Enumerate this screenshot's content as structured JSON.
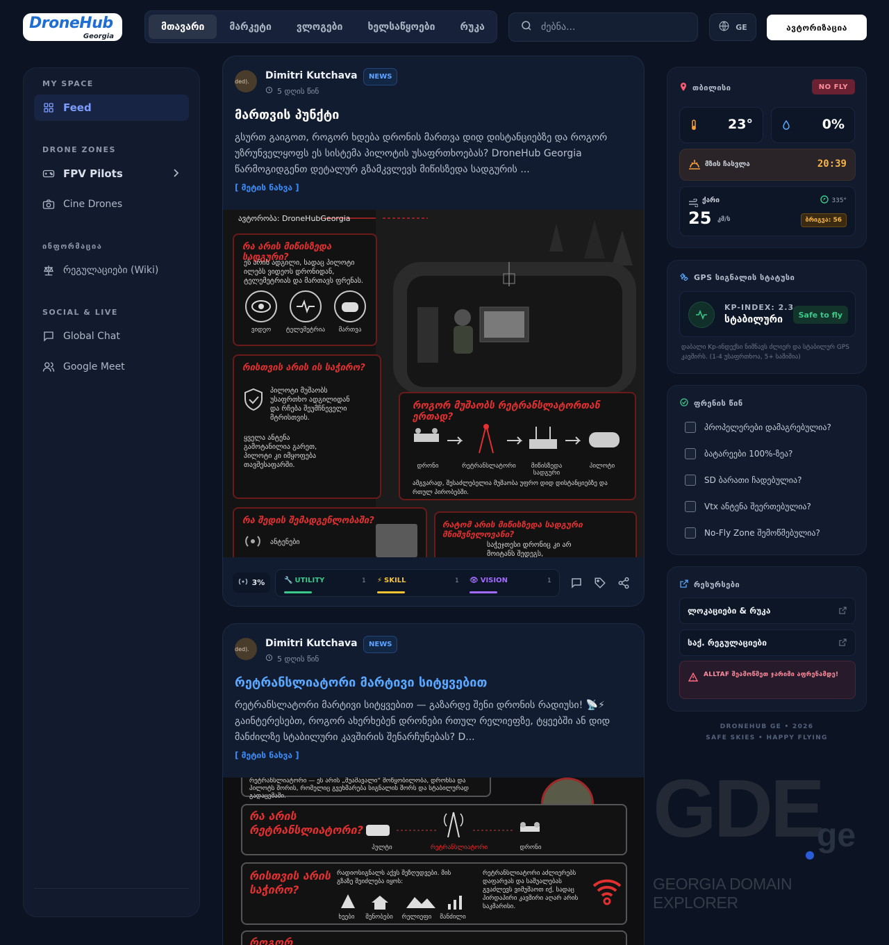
{
  "brand": {
    "name": "DroneHub",
    "sub": "Georgia"
  },
  "nav": {
    "items": [
      "მთავარი",
      "მარკეტი",
      "ვლოგები",
      "ხელსაწყოები",
      "რუკა"
    ],
    "active_index": 0
  },
  "search": {
    "placeholder": "ძებნა..."
  },
  "lang": {
    "code": "GE"
  },
  "auth": {
    "label": "ავტორიზაცია"
  },
  "sidebar": {
    "my_space": "MY SPACE",
    "feed": "Feed",
    "drone_zones": "DRONE ZONES",
    "fpv": "FPV Pilots",
    "cine": "Cine Drones",
    "info": "ინფორმაცია",
    "wiki": "რეგულაციები (Wiki)",
    "social": "SOCIAL & LIVE",
    "chat": "Global Chat",
    "meet": "Google Meet"
  },
  "posts": [
    {
      "avatar_text": "ded).",
      "author": "Dimitri Kutchava",
      "badge": "NEWS",
      "time": "5 დღის წინ",
      "title": "მართვის პუნქტი",
      "body": "გსურთ გაიგოთ, როგორ ხდება დრონის მართვა დიდ დისტანციებზე და როგორ უზრუნველყოფს ეს სისტემა პილოტის უსაფრთხოებას? DroneHub Georgia წარმოგიდგენთ დეტალურ გზამკვლევს მიწისზედა სადგურის ...",
      "more": "[ მეტის ნახვა ]",
      "signal": "3%",
      "stats": [
        {
          "label": "UTILITY",
          "count": "1",
          "color": "#39c98a"
        },
        {
          "label": "SKILL",
          "count": "1",
          "color": "#f4c430"
        },
        {
          "label": "VISION",
          "count": "1",
          "color": "#a36bff"
        }
      ],
      "infographic": {
        "author": "ავტორობა: DroneHubGeorgia",
        "q1": "რა არის მიწისზედა სადგური?",
        "q1_text": "ეს არის ადგილი, სადაც პილოტი ილებს ვიდეოს დრონიდან, ტელემეტრიას და მართავს ფრენას.",
        "icons1": [
          "ვიდეო",
          "ტელემეტრია",
          "მართვა"
        ],
        "q2": "რისთვის არის ის საჭირო?",
        "q2_text1": "პილოტი მუშაობს უსაფრთხო ადგილიდან და რჩება შეუმჩნეველი მტრისთვის.",
        "q2_text2": "ყველა ანტენა გამოტანილია გარეთ, პილოტი კი იმყოფება თავშესაფარში.",
        "q3": "როგორ მუშაობს რეტრანსლატორთან ერთად?",
        "flow": [
          "დრონი",
          "რეტრანსლატორი",
          "მიწისზედა სადგური",
          "პილოტი"
        ],
        "q3_text": "ამგვარად, შესაძლებელია მუშაობა უფრო დიდ დისტანციებზე და რთულ პირობებში.",
        "q4": "რა შედის შემადგენლობაში?",
        "q4_item": "ანტენები",
        "q5": "რატომ არის მიწისზედა სადგური მნიშვნელოვანი?",
        "q5_text": "საჭეჯთესი დრონიც კი არ მოიტანს შედეგს,"
      }
    },
    {
      "avatar_text": "ded).",
      "author": "Dimitri Kutchava",
      "badge": "NEWS",
      "time": "5 დღის წინ",
      "title": "რეტრანსლიატორი მარტივი სიტყვებით",
      "body": "რეტრანსლატორი მარტივი სიტყვებით — გაზარდე შენი დრონის რადიუსი! 📡⚡ გაინტერესებთ, როგორ ახერხებენ დრონები რთულ რელიეფზე, ტყეებში ან დიდ მანძილზე სტაბილური კავშირის შენარჩუნებას? D...",
      "more": "[ მეტის ნახვა ]",
      "infographic": {
        "top": "რეტრანსლიატორი — ეს არის „შუამავალი“ მოწყობილობა, დრონსა და პილოტს შორის, რომელიც გვეხმარება სიგნალის შორს და სტაბილურად გადაცემაში.",
        "q1": "რა არის რეტრანსლიატორი?",
        "row1": [
          "პულტი",
          "რეტრანსლიატორი",
          "დრონი"
        ],
        "q2": "რისთვის არის საჭირო?",
        "q2_text": "რადიოსიგნალს აქვს შეზღუდვები. მის გზაზე შეიძლება იყოს:",
        "obstacles": [
          "ხეები",
          "შენობები",
          "რელიეფი",
          "მანძილი"
        ],
        "q2_right": "რეტრანსლიატორი აძლიერებს დაფარვას და საშუალებას გვაძლევს ვიმუშაოთ იქ, სადაც პირდაპირი კავშირი აღარ არის საკმარისი.",
        "q3": "როგორ"
      }
    }
  ],
  "weather": {
    "city": "თბილისი",
    "status": "NO FLY",
    "temp": "23°",
    "humidity": "0%",
    "sunset_label": "მზის ჩასვლა",
    "sunset_time": "20:39",
    "wind_label": "ქარი",
    "wind_speed": "25",
    "wind_unit": "კმ/ს",
    "wind_dir": "335°",
    "gust": "ბრიგვა: 56"
  },
  "gps": {
    "title": "GPS სიგნალის სტატუსი",
    "kp": "KP-INDEX: 2.3",
    "state": "სტაბილური",
    "badge": "Safe to fly",
    "note": "დაბალი Kp-ინდექსი ნიშნავს ძლიერ და სტაბილურ GPS კავშირს. (1-4 უსაფრთხოა, 5+ საშიშია)"
  },
  "checklist": {
    "title": "ფრენის წინ",
    "items": [
      "პროპელერები დამაგრებულია?",
      "ბატარეები 100%-ზეა?",
      "SD ბარათი ჩადებულია?",
      "Vtx ანტენა შეერთებულია?",
      "No-Fly Zone შემოწმებულია?"
    ]
  },
  "links": {
    "title": "რესურსები",
    "items": [
      "ლოკაციები & რუკა",
      "საქ. რეგულაციები"
    ],
    "warning": "ALLTAF შეამოწმეთ ჯარიმი აფრენამდე!"
  },
  "footer": {
    "line1": "DRONEHUB GE • 2026",
    "line2": "SAFE SKIES • HAPPY FLYING"
  },
  "watermark": {
    "main": "GDE",
    "ge": "ge",
    "sub": "GEORGIA DOMAIN EXPLORER"
  },
  "colors": {
    "bg": "#0c1424",
    "accent": "#3b8cf5",
    "danger": "#ff8d9c",
    "ok": "#39c98a"
  }
}
